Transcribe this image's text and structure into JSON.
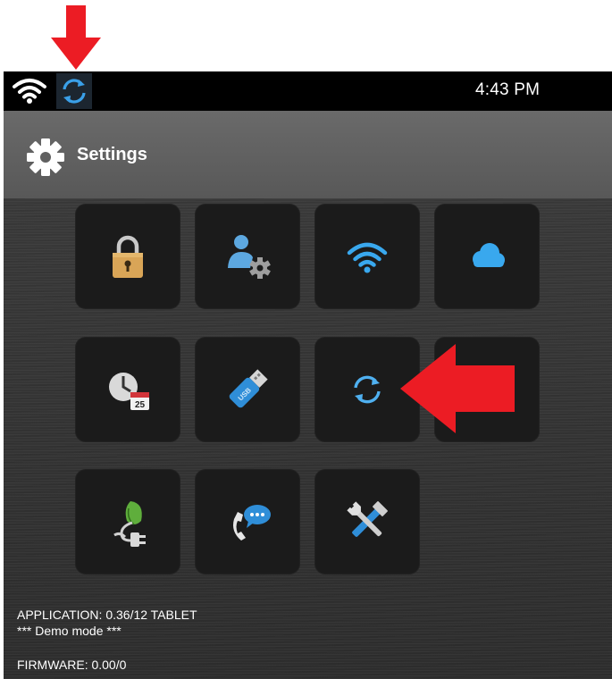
{
  "status_bar": {
    "time": "4:43 PM"
  },
  "header": {
    "title": "Settings"
  },
  "tiles": [
    {
      "icon": "lock-icon"
    },
    {
      "icon": "user-settings-icon"
    },
    {
      "icon": "wifi-icon"
    },
    {
      "icon": "cloud-icon"
    },
    {
      "icon": "date-time-icon"
    },
    {
      "icon": "usb-drive-icon"
    },
    {
      "icon": "sync-icon"
    },
    {
      "icon": "display-icon"
    },
    {
      "icon": "power-save-icon"
    },
    {
      "icon": "support-chat-icon"
    },
    {
      "icon": "tools-icon"
    }
  ],
  "info": {
    "application": "APPLICATION: 0.36/12 TABLET",
    "demo_mode": "*** Demo mode ***",
    "firmware": "FIRMWARE: 0.00/0"
  },
  "colors": {
    "annotation_arrow": "#ec1c24",
    "sync_blue": "#3aa0e8",
    "background": "#333333",
    "tile": "#1b1b1b"
  }
}
